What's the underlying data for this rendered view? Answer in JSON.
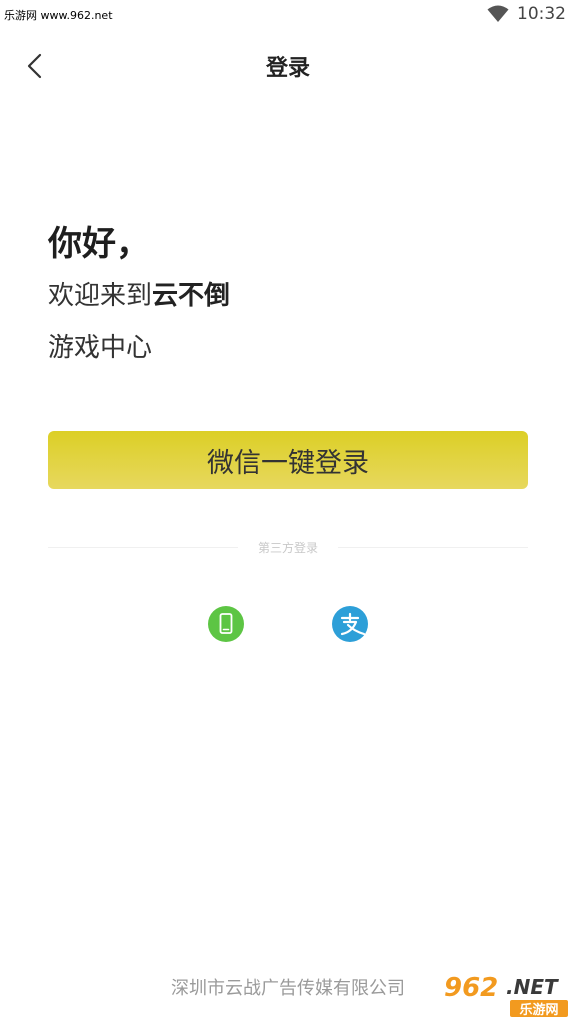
{
  "status_bar": {
    "watermark": "乐游网 www.962.net",
    "time": "10:32",
    "icons": [
      "wifi-icon"
    ]
  },
  "header": {
    "title": "登录",
    "back_icon": "chevron-left-icon"
  },
  "greeting": {
    "hello": "你好，",
    "welcome_prefix": "欢迎来到",
    "brand": "云不倒",
    "line3": "游戏中心"
  },
  "login": {
    "wechat_button": "微信一键登录",
    "third_party_label": "第三方登录",
    "third_party": [
      {
        "icon": "phone-icon",
        "color": "#5dc544"
      },
      {
        "icon": "alipay-icon",
        "color": "#2d9fd8"
      }
    ]
  },
  "footer": {
    "company": "深圳市云战广告传媒有限公司",
    "watermark_logo": "962.NET 乐游网"
  },
  "colors": {
    "accent": "#dccf26",
    "background": "#ffffff"
  }
}
